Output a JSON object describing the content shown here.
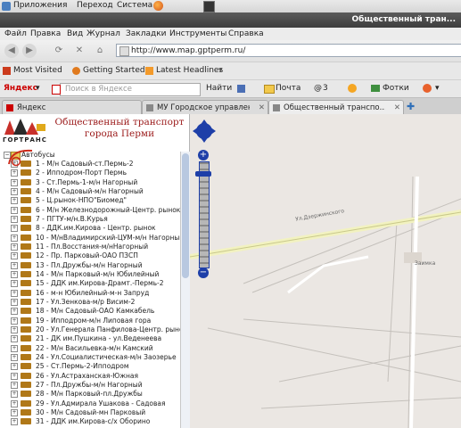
{
  "gnome_menu": [
    "Приложения",
    "Переход",
    "Система"
  ],
  "window_title": "Общественный тран...",
  "menu": [
    "Файл",
    "Правка",
    "Вид",
    "Журнал",
    "Закладки",
    "Инструменты",
    "Справка"
  ],
  "url": "http://www.map.gptperm.ru/",
  "bookmarks": [
    "Most Visited",
    "Getting Started",
    "Latest Headlines"
  ],
  "yandex": {
    "logo": "Яндекс",
    "search_placeholder": "Поиск в Яндексе",
    "find_label": "Найти",
    "mail_label": "Почта",
    "mail_count": "3",
    "photos_label": "Фотки"
  },
  "tabs": [
    "Яндекс",
    "МУ Городское управлен...",
    "Общественный транспо..."
  ],
  "site": {
    "logo_text": "ГОРТРАНС",
    "headline_line1": "Общественный транспорт",
    "headline_line2": "города Перми",
    "root": "Автобусы",
    "routes": [
      "1 - М/н Садовый-ст.Пермь-2",
      "2 - Ипподром-Порт Пермь",
      "3 - Ст.Пермь-1-м/н Нагорный",
      "4 - М/н Садовый-м/н Нагорный",
      "5 - Ц.рынок-НПО\"Биомед\"",
      "6 - М/н Железнодорожный-Центр. рынок",
      "7 - ПГТУ-м/н.В.Курья",
      "8 - ДДК.им.Кирова - Центр. рынок",
      "10 - М/нВладимирский-ЦУМ-м/н Нагорный",
      "11 - Пл.Восстания-м/нНагорный",
      "12 - Пр. Парковый-ОАО ПЗСП",
      "13 - Пл.Дружбы-м/н Нагорный",
      "14 - М/н Парковый-м/н Юбилейный",
      "15 - ДДК им.Кирова-Драмт.-Пермь-2",
      "16 - м-н Юбилейный-м-н Запруд",
      "17 - Ул.Зенкова-м/р Висим-2",
      "18 - М/н Садовый-ОАО Камкабель",
      "19 - Ипподром-м/н Липовая гора",
      "20 - Ул.Генерала Панфилова-Центр. рынок",
      "21 - ДК им.Пушкина - ул.Веденеева",
      "22 - М/н Васильевка-м/н Камский",
      "24 - Ул.Социалистическая-м/н Заозерье",
      "25 - Ст.Пермь-2-Ипподром",
      "26 - Ул.Астраханская-Южная",
      "27 - Пл.Дружбы-м/н Нагорный",
      "28 - М/н Парковый-пл.Дружбы",
      "29 - Ул.Адмирала Ушакова - Садовая",
      "30 - М/н Садовый-мн Парковый",
      "31 - ДДК им.Кирова-с/х Оборино"
    ]
  },
  "map_labels": {
    "street": "Ул.Дзержинского",
    "label2": "Заимка"
  },
  "colors": {
    "headline": "#9b1a1a",
    "zoom_control": "#1e3fa8",
    "bus_icon": "#b07818",
    "annotation": "#cc2a1a"
  }
}
